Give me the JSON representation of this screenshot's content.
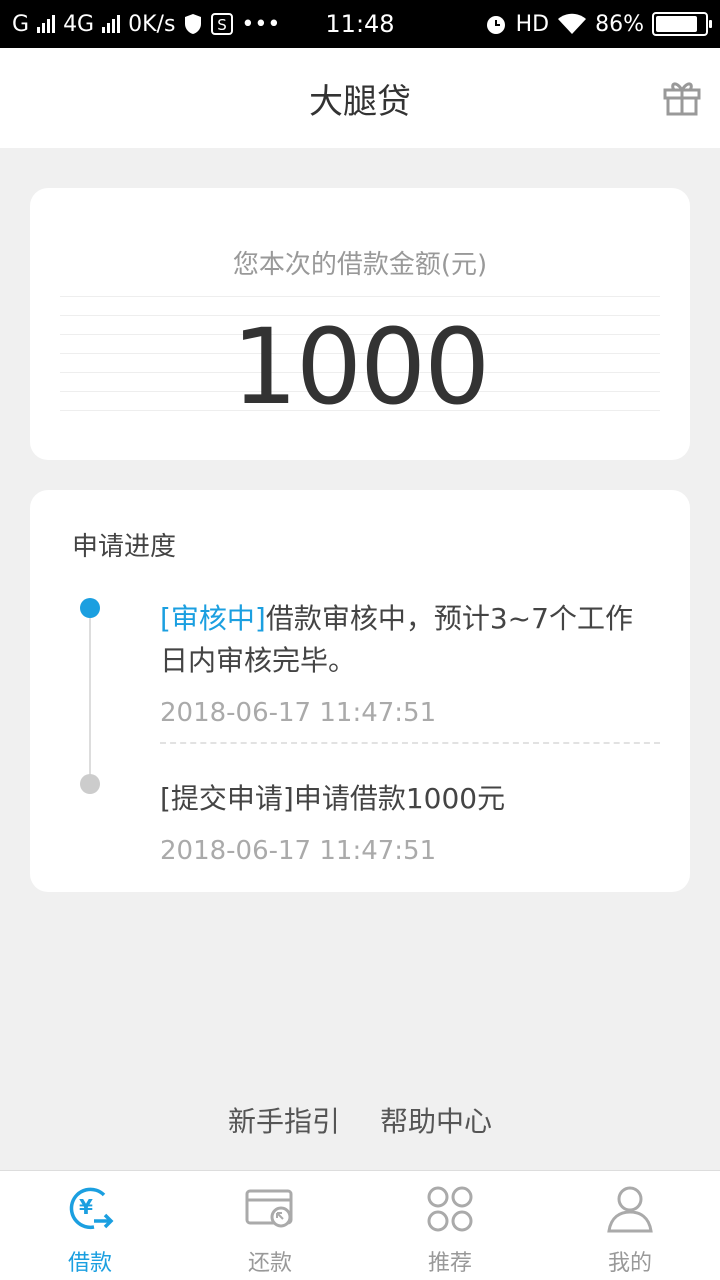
{
  "status_bar": {
    "carrier": "G",
    "network": "4G",
    "speed": "0K/s",
    "time": "11:48",
    "hd": "HD",
    "battery_text": "86%",
    "battery_level": 0.86
  },
  "header": {
    "title": "大腿贷",
    "icon": "gift-icon"
  },
  "amount_card": {
    "label": "您本次的借款金额(元)",
    "amount": "1000"
  },
  "progress": {
    "title": "申请进度",
    "steps": [
      {
        "tag": "[审核中]",
        "text": "借款审核中，预计3~7个工作日内审核完毕。",
        "time": "2018-06-17 11:47:51",
        "active": true
      },
      {
        "tag": "[提交申请]",
        "text": "申请借款1000元",
        "time": "2018-06-17 11:47:51",
        "active": false
      }
    ]
  },
  "footer_links": {
    "guide": "新手指引",
    "help": "帮助中心"
  },
  "bottom_nav": {
    "items": [
      {
        "label": "借款",
        "icon": "loan-icon",
        "active": true
      },
      {
        "label": "还款",
        "icon": "repay-icon",
        "active": false
      },
      {
        "label": "推荐",
        "icon": "recommend-icon",
        "active": false
      },
      {
        "label": "我的",
        "icon": "profile-icon",
        "active": false
      }
    ]
  },
  "colors": {
    "accent": "#1b9fe0",
    "background": "#f0f0f0",
    "inactive": "#999999"
  }
}
